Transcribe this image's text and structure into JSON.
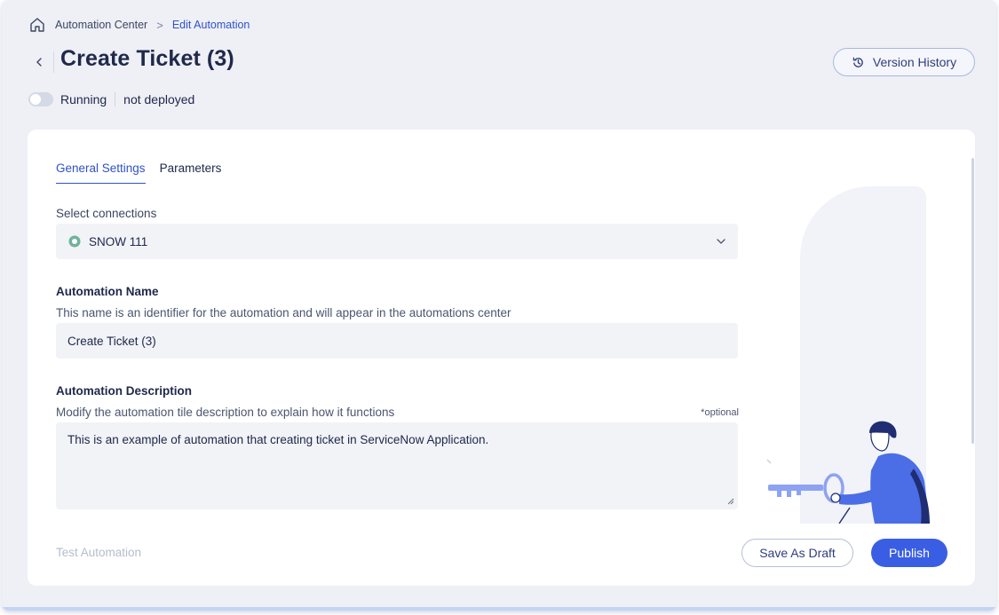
{
  "breadcrumb": {
    "home_icon": "home-icon",
    "items": [
      "Automation Center",
      "Edit Automation"
    ],
    "separator": ">"
  },
  "header": {
    "back_icon": "chevron-left-icon",
    "title": "Create Ticket (3)",
    "version_history_label": "Version History",
    "version_history_icon": "history-icon"
  },
  "status": {
    "toggle_on": false,
    "running_label": "Running",
    "deploy_state": "not deployed"
  },
  "tabs": [
    {
      "label": "General Settings",
      "active": true
    },
    {
      "label": "Parameters",
      "active": false
    }
  ],
  "connections": {
    "label": "Select connections",
    "selected": "SNOW 111",
    "icon": "connection-icon",
    "dropdown_icon": "chevron-down-icon"
  },
  "automation_name": {
    "title": "Automation Name",
    "hint": "This name is an identifier for the automation and will appear in the automations center",
    "value": "Create Ticket (3)"
  },
  "automation_description": {
    "title": "Automation Description",
    "hint": "Modify the automation tile description to explain how it functions",
    "optional_label": "*optional",
    "value": "This is an example of automation that creating ticket in ServiceNow Application."
  },
  "footer": {
    "test_label": "Test Automation",
    "draft_label": "Save As Draft",
    "publish_label": "Publish"
  },
  "colors": {
    "accent": "#3a5ee3",
    "link": "#2f52c9",
    "title": "#20294a",
    "background": "#eef0f6"
  }
}
